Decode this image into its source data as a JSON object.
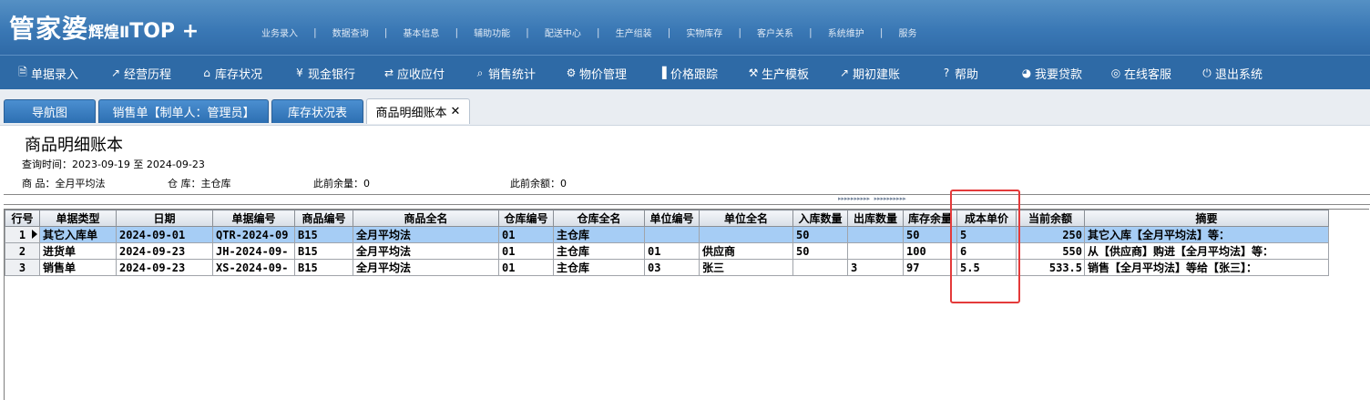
{
  "header": {
    "logo_main": "管家婆",
    "logo_sub": "辉煌Ⅱ",
    "logo_plus": "TOP +",
    "top_menu": [
      "业务录入",
      "数据查询",
      "基本信息",
      "辅助功能",
      "配送中心",
      "生产组装",
      "实物库存",
      "客户关系",
      "系统维护",
      "服务"
    ]
  },
  "toolbar": [
    {
      "label": "单据录入",
      "icon": "document-icon"
    },
    {
      "label": "经营历程",
      "icon": "chart-line-icon"
    },
    {
      "label": "库存状况",
      "icon": "home-icon"
    },
    {
      "label": "现金银行",
      "icon": "yen-icon"
    },
    {
      "label": "应收应付",
      "icon": "arrows-icon"
    },
    {
      "label": "销售统计",
      "icon": "search-icon"
    },
    {
      "label": "物价管理",
      "icon": "gear-icon"
    },
    {
      "label": "价格跟踪",
      "icon": "bar-chart-icon"
    },
    {
      "label": "生产模板",
      "icon": "wrench-icon"
    },
    {
      "label": "期初建账",
      "icon": "external-link-icon"
    },
    {
      "label": "帮助",
      "icon": "question-icon"
    },
    {
      "label": "我要贷款",
      "icon": "money-bag-icon"
    },
    {
      "label": "在线客服",
      "icon": "headset-icon"
    },
    {
      "label": "退出系统",
      "icon": "power-icon"
    }
  ],
  "tabs": [
    {
      "label": "导航图"
    },
    {
      "label": "销售单【制单人：管理员】"
    },
    {
      "label": "库存状况表"
    },
    {
      "label": "商品明细账本",
      "close": "✕"
    }
  ],
  "report": {
    "title": "商品明细账本",
    "query_time": "查询时间：2023-09-19 至 2024-09-23",
    "product": "商    品：全月平均法",
    "warehouse": "仓      库：主仓库",
    "prev_qty": "此前余量：0",
    "prev_amount": "此前余额：0"
  },
  "grid": {
    "columns": [
      "行号",
      "单据类型",
      "日期",
      "单据编号",
      "商品编号",
      "商品全名",
      "仓库编号",
      "仓库全名",
      "单位编号",
      "单位全名",
      "入库数量",
      "出库数量",
      "库存余量",
      "成本单价",
      "当前余额",
      "摘要"
    ],
    "rows": [
      [
        "1",
        "其它入库单",
        "2024-09-01",
        "QTR-2024-09",
        "B15",
        "全月平均法",
        "01",
        "主仓库",
        "",
        "",
        "50",
        "",
        "50",
        "5",
        "250",
        "其它入库【全月平均法】等："
      ],
      [
        "2",
        "进货单",
        "2024-09-23",
        "JH-2024-09-",
        "B15",
        "全月平均法",
        "01",
        "主仓库",
        "01",
        "供应商",
        "50",
        "",
        "100",
        "6",
        "550",
        "从【供应商】购进【全月平均法】等："
      ],
      [
        "3",
        "销售单",
        "2024-09-23",
        "XS-2024-09-",
        "B15",
        "全月平均法",
        "01",
        "主仓库",
        "03",
        "张三",
        "",
        "3",
        "97",
        "5.5",
        "533.5",
        "销售【全月平均法】等给【张三】："
      ]
    ],
    "selected_row": 1
  },
  "colors": {
    "header_bg": "#3a78b5",
    "toolbar_bg": "#2e6aa6",
    "tab_bg": "#2d6fb2",
    "selected_row": "#a6cdf5",
    "highlight_box": "#e43a3a"
  }
}
